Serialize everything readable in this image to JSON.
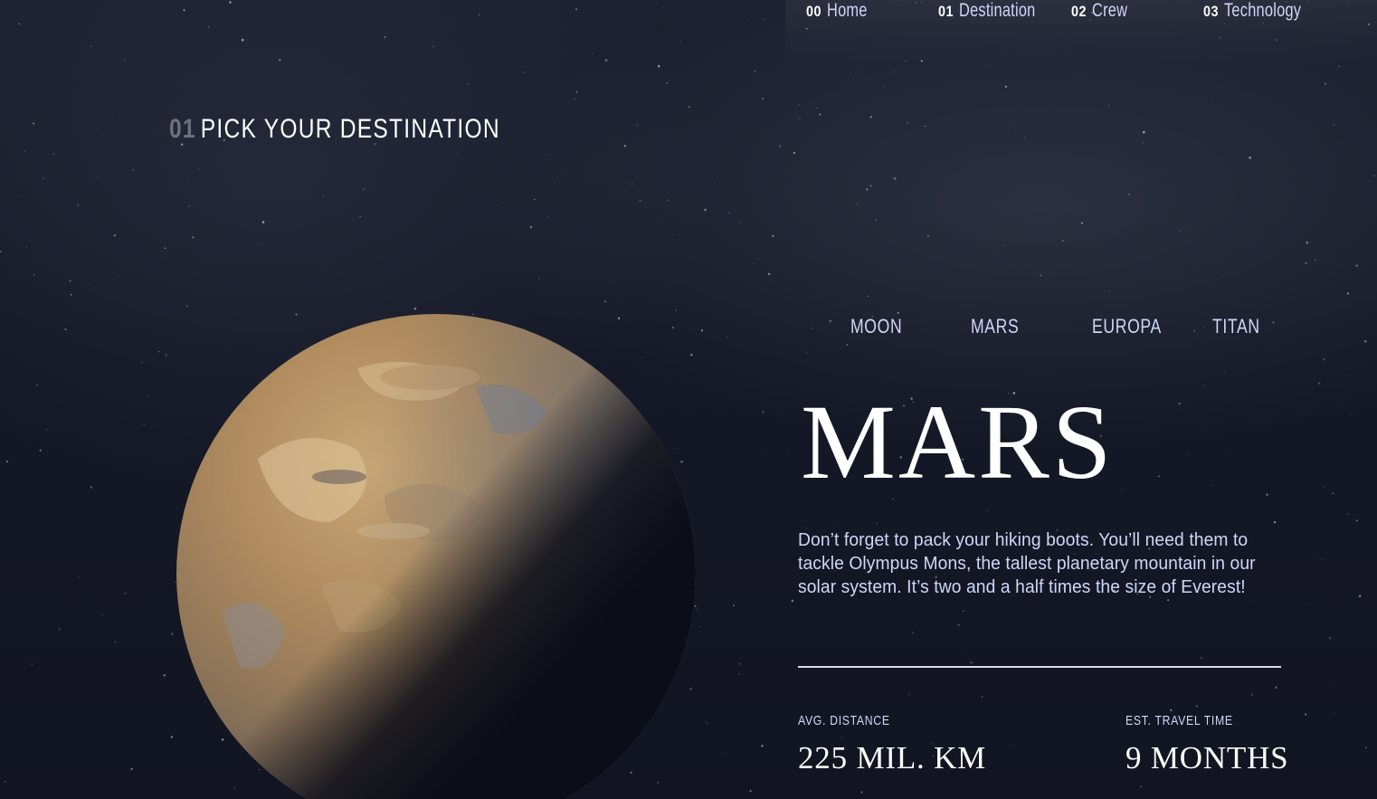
{
  "nav": {
    "items": [
      {
        "num": "00",
        "label": "Home"
      },
      {
        "num": "01",
        "label": "Destination"
      },
      {
        "num": "02",
        "label": "Crew"
      },
      {
        "num": "03",
        "label": "Technology"
      }
    ]
  },
  "heading": {
    "num": "01",
    "text": "PICK YOUR DESTINATION"
  },
  "tabs": [
    "MOON",
    "MARS",
    "EUROPA",
    "TITAN"
  ],
  "destination": {
    "name": "MARS",
    "description": "Don’t forget to pack your hiking boots. You’ll need them to tackle Olympus Mons, the tallest planetary mountain in our solar system. It’s two and a half times the size of Everest!",
    "stats": [
      {
        "label": "AVG. DISTANCE",
        "value": "225 MIL. KM"
      },
      {
        "label": "EST. TRAVEL TIME",
        "value": "9 MONTHS"
      }
    ]
  },
  "colors": {
    "background": "#0b0d17",
    "accent_text": "#d0d6f9",
    "white": "#ffffff",
    "planet_surface": "#b8905f"
  },
  "images": {
    "planet": "mars-planet-image",
    "background": "starfield-background"
  }
}
